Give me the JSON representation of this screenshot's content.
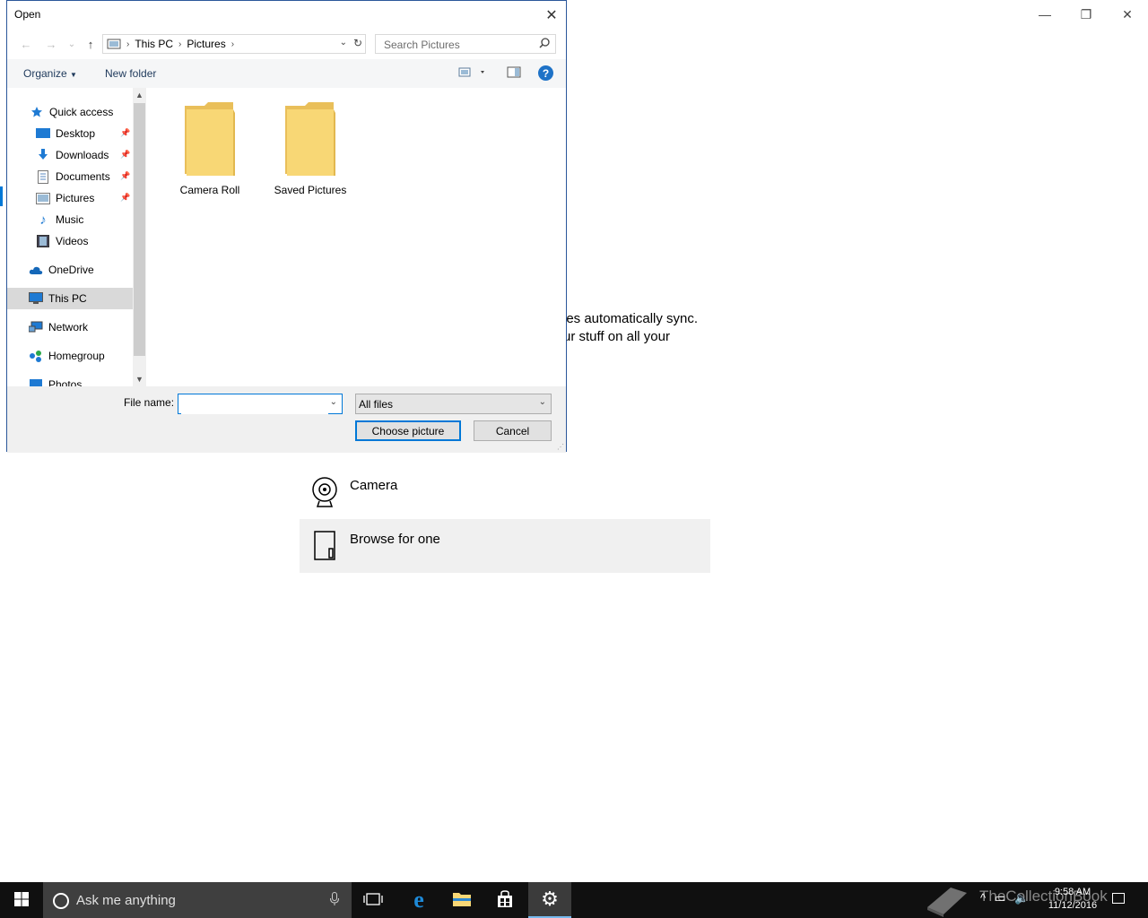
{
  "background": {
    "window_controls": {
      "minimize": "—",
      "restore": "❐",
      "close": "✕"
    },
    "text_line_1": "les automatically sync.",
    "text_line_2": "ur stuff on all your",
    "options": [
      {
        "label": "Camera",
        "icon": "camera-icon"
      },
      {
        "label": "Browse for one",
        "icon": "browse-icon"
      }
    ]
  },
  "dialog": {
    "title": "Open",
    "close_glyph": "✕",
    "nav": {
      "back": "←",
      "forward": "→",
      "recent": "⌄",
      "up": "↑",
      "breadcrumb": [
        "This PC",
        "Pictures"
      ],
      "search_placeholder": "Search Pictures"
    },
    "toolbar": {
      "organize_label": "Organize",
      "new_folder_label": "New folder",
      "help_glyph": "?"
    },
    "navpane": {
      "items": [
        {
          "label": "Quick access",
          "icon": "star-icon",
          "pinned": false
        },
        {
          "label": "Desktop",
          "icon": "desktop-icon",
          "pinned": true
        },
        {
          "label": "Downloads",
          "icon": "download-icon",
          "pinned": true
        },
        {
          "label": "Documents",
          "icon": "documents-icon",
          "pinned": true
        },
        {
          "label": "Pictures",
          "icon": "pictures-icon",
          "pinned": true
        },
        {
          "label": "Music",
          "icon": "music-icon",
          "pinned": false
        },
        {
          "label": "Videos",
          "icon": "videos-icon",
          "pinned": false
        },
        {
          "label": "OneDrive",
          "icon": "cloud-icon",
          "pinned": false
        },
        {
          "label": "This PC",
          "icon": "computer-icon",
          "pinned": false,
          "selected": true
        },
        {
          "label": "Network",
          "icon": "network-icon",
          "pinned": false
        },
        {
          "label": "Homegroup",
          "icon": "homegroup-icon",
          "pinned": false
        },
        {
          "label": "Photos",
          "icon": "photos-icon",
          "pinned": false
        }
      ]
    },
    "files": [
      {
        "name": "Camera Roll"
      },
      {
        "name": "Saved Pictures"
      }
    ],
    "bottom": {
      "file_name_label": "File name:",
      "file_name_value": "",
      "filter_value": "All files",
      "choose_label": "Choose picture",
      "cancel_label": "Cancel"
    }
  },
  "taskbar": {
    "search_placeholder": "Ask me anything",
    "apps": [
      "task-view-icon",
      "edge-icon",
      "file-explorer-icon",
      "store-icon",
      "settings-icon"
    ],
    "watermark": "TheCollectionBook",
    "time": "9:58 AM",
    "date": "11/12/2016"
  },
  "colors": {
    "accent": "#0078d7",
    "folder": "#f8d775",
    "taskbar": "#101010"
  }
}
